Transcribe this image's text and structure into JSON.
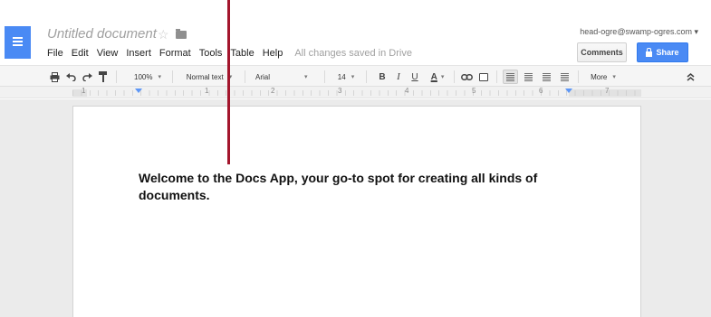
{
  "document": {
    "title": "Untitled document",
    "body_text": "Welcome to the Docs App, your go-to spot for creating all kinds of documents."
  },
  "menu": {
    "items": [
      "File",
      "Edit",
      "View",
      "Insert",
      "Format",
      "Tools",
      "Table",
      "Help"
    ],
    "save_status": "All changes saved in Drive"
  },
  "account": {
    "email": "head-ogre@swamp-ogres.com ▾"
  },
  "buttons": {
    "comments": "Comments",
    "share": "Share"
  },
  "toolbar": {
    "zoom": "100%",
    "style": "Normal text",
    "font": "Arial",
    "size": "14",
    "bold": "B",
    "italic": "I",
    "underline": "U",
    "text_color": "A",
    "more": "More",
    "caret": "▾"
  },
  "ruler": {
    "numbers": [
      "1",
      "1",
      "2",
      "3",
      "4",
      "5",
      "6",
      "7"
    ]
  },
  "colors": {
    "brand": "#4a8af4",
    "annotation_line": "#a3152c"
  },
  "icons": [
    "docs-menu-icon",
    "star-icon",
    "folder-icon",
    "print-icon",
    "undo-icon",
    "redo-icon",
    "paint-format-icon",
    "link-icon",
    "comment-icon",
    "align-left-icon",
    "align-center-icon",
    "align-right-icon",
    "justify-icon",
    "collapse-icon",
    "lock-icon"
  ]
}
